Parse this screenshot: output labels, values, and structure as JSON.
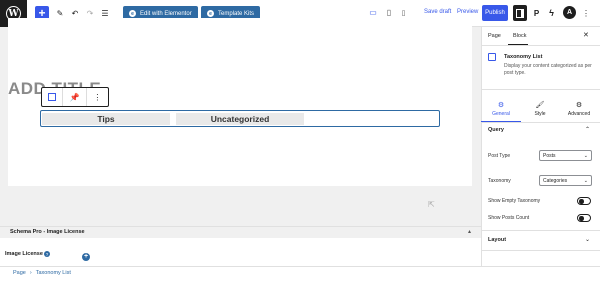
{
  "topbar": {
    "edit_elementor": "Edit with Elementor",
    "template_kits": "Template Kits",
    "save_draft": "Save draft",
    "preview": "Preview",
    "publish": "Publish"
  },
  "canvas": {
    "title_placeholder": "ADD TITLE",
    "taxonomy_items": [
      "Tips",
      "Uncategorized"
    ]
  },
  "metabox": {
    "title": "Schema Pro - Image License",
    "image_license_label": "Image License"
  },
  "breadcrumb": [
    "Page",
    "Taxonomy List"
  ],
  "sidebar": {
    "tabs": [
      "Page",
      "Block"
    ],
    "block_title": "Taxonomy List",
    "block_desc": "Display your content categorized as per post type.",
    "subtabs": [
      "General",
      "Style",
      "Advanced"
    ],
    "query_section": "Query",
    "post_type_label": "Post Type",
    "post_type_value": "Posts",
    "taxonomy_label": "Taxonomy",
    "taxonomy_value": "Categories",
    "show_empty_label": "Show Empty Taxonomy",
    "show_count_label": "Show Posts Count",
    "layout_section": "Layout"
  },
  "colors": {
    "accent": "#3858e9",
    "elementor_blue": "#2e6aa3",
    "dark": "#1e1e1e"
  }
}
